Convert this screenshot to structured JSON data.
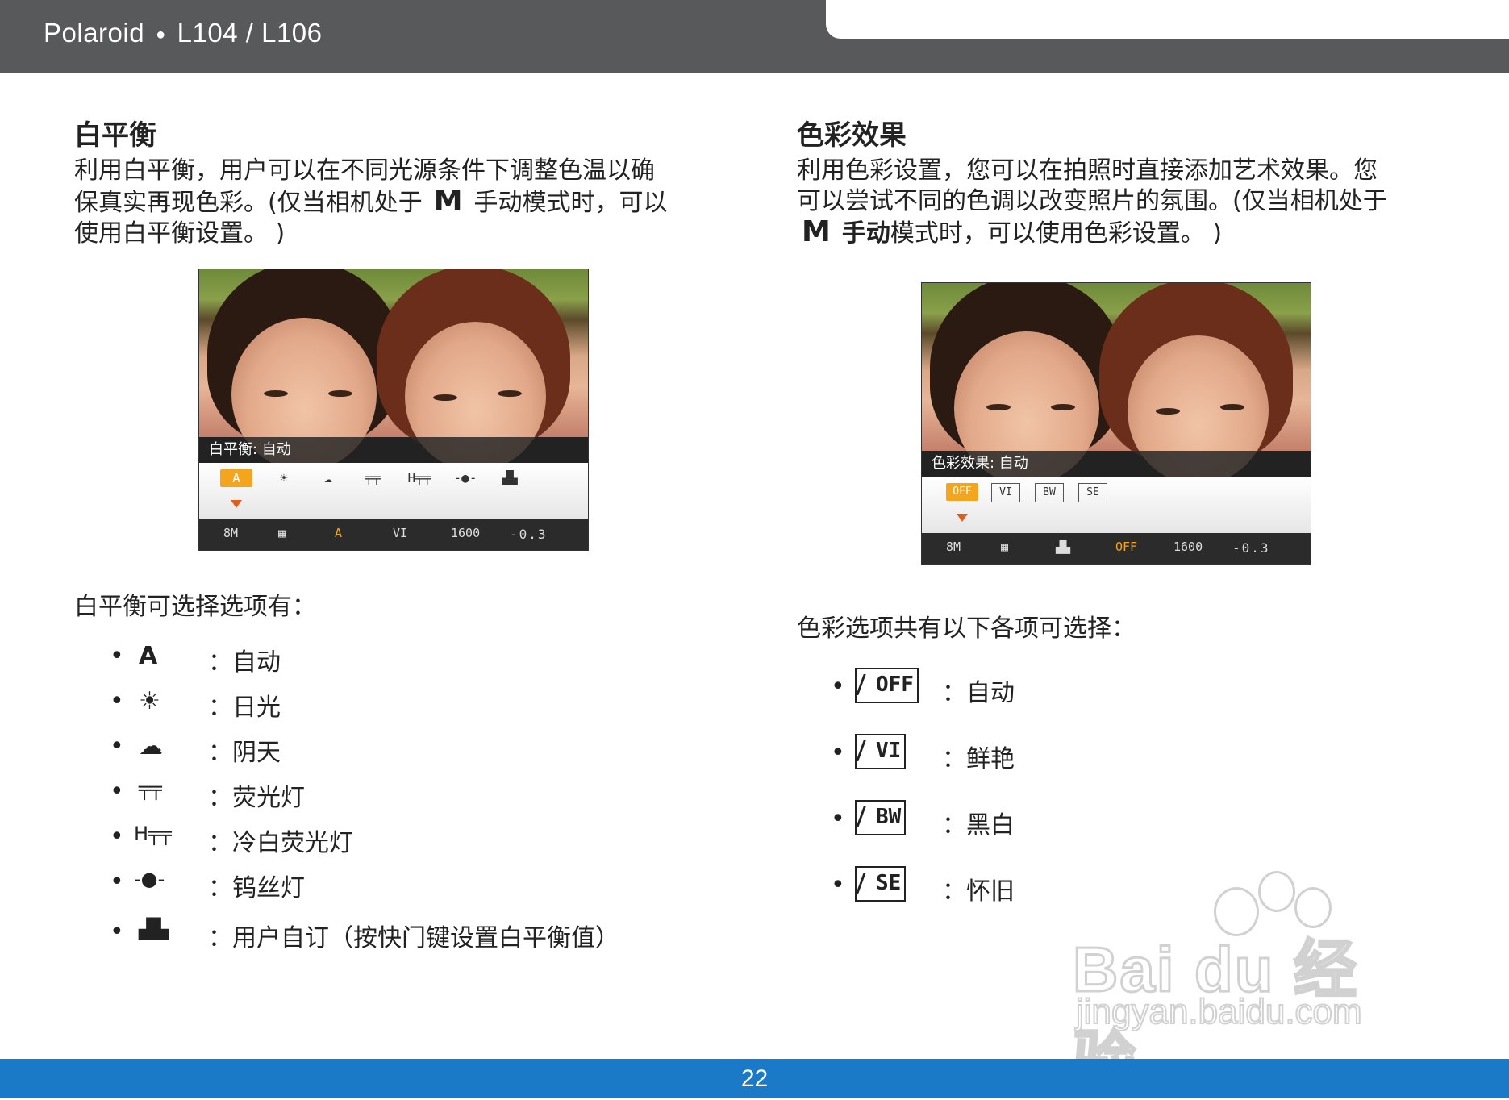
{
  "header": {
    "brand": "Polaroid",
    "separator": "●",
    "model": "L104 / L106"
  },
  "footer": {
    "page_number": "22"
  },
  "left": {
    "title": "白平衡",
    "para_line1": "利用白平衡，用户可以在不同光源条件下调整色温以确",
    "para_line2a": "保真实再现色彩。(仅当相机处于",
    "m_icon": "M",
    "para_line2b": "手动模式时，可以",
    "para_line3": "使用白平衡设置。 )",
    "screen": {
      "osd_label": "白平衡: 自动",
      "tray_icons": [
        "A",
        "☀",
        "☁",
        "╤╤",
        "H╤╤",
        "-●-",
        "▟▙"
      ],
      "bar_icons": [
        "8M",
        "▦",
        "A",
        "VI",
        "1600"
      ],
      "ev_value": "-0.3"
    },
    "options_intro": "白平衡可选择选项有：",
    "options": [
      {
        "icon": "auto-wb-icon",
        "glyph": "A",
        "label": "：自动"
      },
      {
        "icon": "daylight-icon",
        "glyph": "☀",
        "label": "：日光"
      },
      {
        "icon": "cloudy-icon",
        "glyph": "☁",
        "label": "：阴天"
      },
      {
        "icon": "fluorescent-icon",
        "glyph": "╤╤",
        "label": "：荧光灯"
      },
      {
        "icon": "cool-white-fluorescent-icon",
        "glyph": "H╤╤",
        "label": "：冷白荧光灯"
      },
      {
        "icon": "tungsten-icon",
        "glyph": "-●-",
        "label": "：钨丝灯"
      },
      {
        "icon": "custom-wb-icon",
        "glyph": "▟▙",
        "label": "：用户自订（按快门键设置白平衡值）"
      }
    ]
  },
  "right": {
    "title": "色彩效果",
    "para_line1": "利用色彩设置，您可以在拍照时直接添加艺术效果。您",
    "para_line2": "可以尝试不同的色调以改变照片的氛围。(仅当相机处于",
    "m_icon": "M",
    "para_line3a": "手动",
    "para_line3b": "模式时，可以使用色彩设置。 )",
    "screen": {
      "osd_label": "色彩效果: 自动",
      "tray_icons": [
        "OFF",
        "VI",
        "BW",
        "SE"
      ],
      "bar_icons": [
        "8M",
        "▦",
        "▟▙",
        "OFF",
        "1600"
      ],
      "ev_value": "-0.3"
    },
    "options_intro": "色彩选项共有以下各项可选择：",
    "options": [
      {
        "icon": "color-off-icon",
        "glyph": "OFF",
        "label": "：自动"
      },
      {
        "icon": "color-vivid-icon",
        "glyph": "VI",
        "label": "：鲜艳"
      },
      {
        "icon": "color-bw-icon",
        "glyph": "BW",
        "label": "：黑白"
      },
      {
        "icon": "color-sepia-icon",
        "glyph": "SE",
        "label": "：怀旧"
      }
    ]
  },
  "watermark": {
    "main": "Bai du 经验",
    "sub": "jingyan.baidu.com"
  },
  "colors": {
    "header_bg": "#58595b",
    "footer_bg": "#1a7ac8",
    "accent_orange": "#f3a51e",
    "arrow": "#e0601b"
  }
}
